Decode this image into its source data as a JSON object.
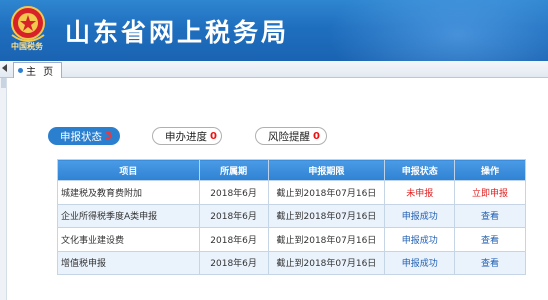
{
  "header": {
    "site_title": "山东省网上税务局",
    "logo_text": "中国税务"
  },
  "tabbar": {
    "home_tab": "主 页"
  },
  "subtabs": [
    {
      "label": "申报状态",
      "count": "3"
    },
    {
      "label": "申办进度",
      "count": "0"
    },
    {
      "label": "风险提醒",
      "count": "0"
    }
  ],
  "table": {
    "headers": [
      "项目",
      "所属期",
      "申报期限",
      "申报状态",
      "操作"
    ],
    "rows": [
      {
        "item": "城建税及教育费附加",
        "period": "2018年6月",
        "deadline": "截止到2018年07月16日",
        "status": "未申报",
        "action": "立即申报"
      },
      {
        "item": "企业所得税季度A类申报",
        "period": "2018年6月",
        "deadline": "截止到2018年07月16日",
        "status": "申报成功",
        "action": "查看"
      },
      {
        "item": "文化事业建设费",
        "period": "2018年6月",
        "deadline": "截止到2018年07月16日",
        "status": "申报成功",
        "action": "查看"
      },
      {
        "item": "增值税申报",
        "period": "2018年6月",
        "deadline": "截止到2018年07月16日",
        "status": "申报成功",
        "action": "查看"
      }
    ]
  },
  "colors": {
    "header_blue": "#1f6fbf",
    "active_tab": "#2a7fcf",
    "status_red": "#e02020",
    "status_blue": "#1f5fb3"
  }
}
